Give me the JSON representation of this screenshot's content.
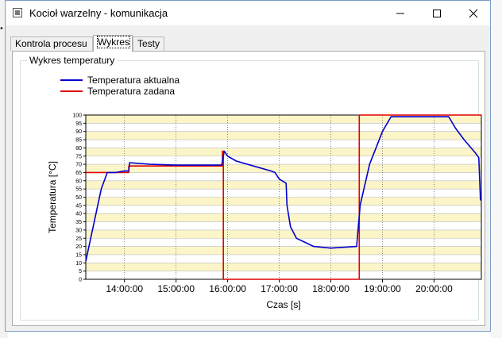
{
  "window": {
    "title": "Kocioł warzelny - komunikacja",
    "minimize_icon": "minimize-icon",
    "maximize_icon": "maximize-icon",
    "close_icon": "close-icon"
  },
  "tabs": [
    {
      "label": "Kontrola procesu",
      "active": false
    },
    {
      "label": "Wykres",
      "active": true
    },
    {
      "label": "Testy",
      "active": false
    }
  ],
  "group": {
    "title": "Wykres temperatury"
  },
  "colors": {
    "actual": "#0000d0",
    "setpoint": "#e00000",
    "band_yellow": "#fbf5c8",
    "band_white": "#ffffff"
  },
  "chart_data": {
    "type": "line",
    "title": "",
    "xlabel": "Czas [s]",
    "ylabel": "Temperatura [°C]",
    "xlim": [
      "13:15:00",
      "20:55:00"
    ],
    "ylim": [
      0,
      100
    ],
    "grid": true,
    "legend_position": "top-left",
    "x_ticks": [
      "14:00:00",
      "15:00:00",
      "16:00:00",
      "17:00:00",
      "18:00:00",
      "19:00:00",
      "20:00:00"
    ],
    "y_ticks": [
      0,
      5,
      10,
      15,
      20,
      25,
      30,
      35,
      40,
      45,
      50,
      55,
      60,
      65,
      70,
      75,
      80,
      85,
      90,
      95,
      100
    ],
    "series": [
      {
        "name": "Temperatura aktualna",
        "color": "#0000d0",
        "points": [
          [
            "13:15:00",
            11
          ],
          [
            "13:33:00",
            55
          ],
          [
            "13:40:00",
            65
          ],
          [
            "13:50:00",
            65
          ],
          [
            "14:00:00",
            66
          ],
          [
            "14:05:00",
            66
          ],
          [
            "14:06:00",
            71
          ],
          [
            "14:30:00",
            70
          ],
          [
            "15:00:00",
            69.5
          ],
          [
            "15:30:00",
            69.5
          ],
          [
            "15:53:00",
            69.5
          ],
          [
            "15:56:00",
            78
          ],
          [
            "16:00:00",
            75
          ],
          [
            "16:10:00",
            72
          ],
          [
            "16:30:00",
            69
          ],
          [
            "16:50:00",
            66
          ],
          [
            "16:55:00",
            65
          ],
          [
            "17:00:00",
            61
          ],
          [
            "17:08:00",
            58.5
          ],
          [
            "17:09:00",
            45
          ],
          [
            "17:13:00",
            32
          ],
          [
            "17:20:00",
            25
          ],
          [
            "17:40:00",
            20
          ],
          [
            "18:00:00",
            19
          ],
          [
            "18:30:00",
            20
          ],
          [
            "18:34:00",
            45
          ],
          [
            "18:45:00",
            70
          ],
          [
            "19:00:00",
            90
          ],
          [
            "19:10:00",
            99
          ],
          [
            "19:30:00",
            99
          ],
          [
            "20:00:00",
            99
          ],
          [
            "20:17:00",
            99
          ],
          [
            "20:25:00",
            92
          ],
          [
            "20:35:00",
            85
          ],
          [
            "20:48:00",
            77
          ],
          [
            "20:52:00",
            74
          ],
          [
            "20:54:00",
            48
          ]
        ]
      },
      {
        "name": "Temperatura zadana",
        "color": "#e00000",
        "points": [
          [
            "13:15:00",
            65
          ],
          [
            "14:05:00",
            65
          ],
          [
            "14:05:00",
            69
          ],
          [
            "15:54:00",
            69
          ],
          [
            "15:54:00",
            78
          ],
          [
            "15:55:00",
            78
          ],
          [
            "15:55:00",
            0
          ],
          [
            "18:33:00",
            0
          ],
          [
            "18:33:00",
            100
          ],
          [
            "20:55:00",
            100
          ]
        ]
      }
    ]
  }
}
